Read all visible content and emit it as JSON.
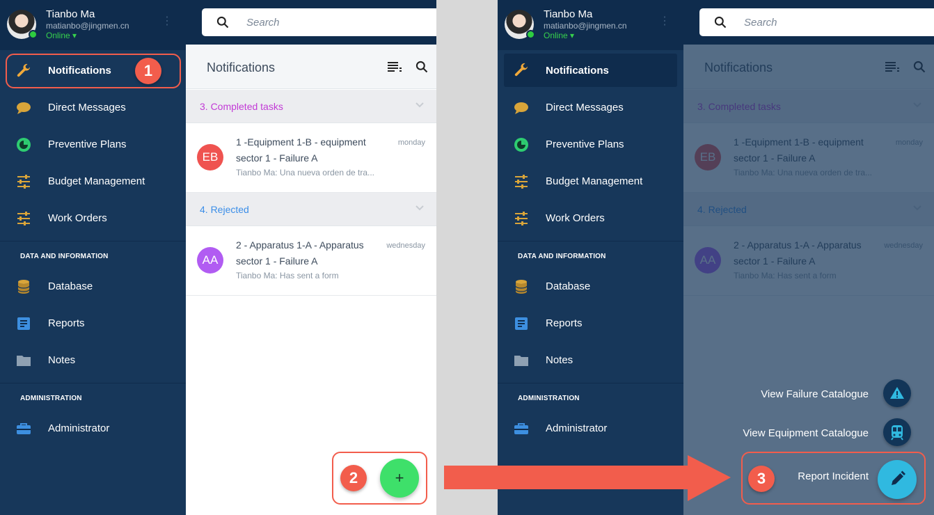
{
  "profile": {
    "name": "Tianbo Ma",
    "email": "matianbo@jingmen.cn",
    "status": "Online ▾"
  },
  "search": {
    "placeholder": "Search"
  },
  "nav": {
    "items": [
      {
        "label": "Notifications",
        "icon": "wrench-icon"
      },
      {
        "label": "Direct Messages",
        "icon": "chat-bubble-icon"
      },
      {
        "label": "Preventive Plans",
        "icon": "timer-icon"
      },
      {
        "label": "Budget Management",
        "icon": "sliders-icon"
      },
      {
        "label": "Work Orders",
        "icon": "sliders-icon"
      }
    ],
    "section_data": "DATA AND INFORMATION",
    "data_items": [
      {
        "label": "Database",
        "icon": "database-icon"
      },
      {
        "label": "Reports",
        "icon": "document-icon"
      },
      {
        "label": "Notes",
        "icon": "folder-icon"
      }
    ],
    "section_admin": "ADMINISTRATION",
    "admin_items": [
      {
        "label": "Administrator",
        "icon": "toolbox-icon"
      }
    ]
  },
  "notifications": {
    "title": "Notifications",
    "groups": [
      {
        "label": "3. Completed tasks",
        "color": "#c23ad6",
        "items": [
          {
            "initials": "EB",
            "avatar_color": "#ef5350",
            "title": "1 -Equipment 1-B - equipment sector 1 - Failure A",
            "date": "monday",
            "subtitle": "Tianbo Ma: Una nueva orden de tra..."
          }
        ]
      },
      {
        "label": "4. Rejected",
        "color": "#3b8ee8",
        "items": [
          {
            "initials": "AA",
            "avatar_color": "#b15cf2",
            "title": "2 - Apparatus 1-A - Apparatus sector 1 - Failure A",
            "date": "wednesday",
            "subtitle": "Tianbo Ma: Has sent a form"
          }
        ]
      }
    ]
  },
  "fab": {
    "add_label": "+"
  },
  "speed_dial": {
    "failure": "View Failure Catalogue",
    "equipment": "View Equipment Catalogue",
    "incident": "Report Incident"
  },
  "callouts": [
    "1",
    "2",
    "3"
  ],
  "colors": {
    "sidebar": "#17375a",
    "topbar": "#0f2c4d",
    "accent_green": "#3ee06a",
    "accent_blue": "#30b9e0",
    "callout": "#f25d4c"
  }
}
